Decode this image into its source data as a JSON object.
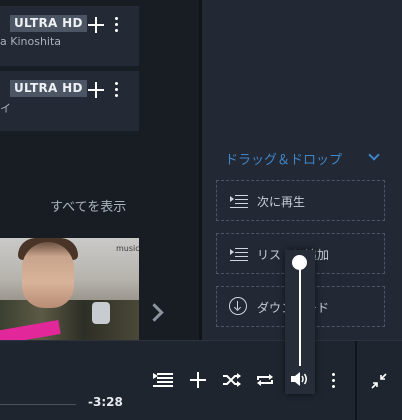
{
  "tracks": [
    {
      "badge": "ULTRA HD",
      "artist": "a Kinoshita"
    },
    {
      "badge": "ULTRA HD",
      "artist": "イ"
    }
  ],
  "see_all": "すべてを表示",
  "album": {
    "logo_text": "music"
  },
  "drop_panel": {
    "title": "ドラッグ＆ドロップ",
    "targets": [
      {
        "label": "次に再生",
        "icon": "queue-next-icon"
      },
      {
        "label": "リストに追加",
        "icon": "add-to-list-icon"
      },
      {
        "label": "ダウンロード",
        "icon": "download-icon"
      }
    ]
  },
  "player": {
    "time_remaining": "-3:28",
    "volume_level": 1.0
  }
}
